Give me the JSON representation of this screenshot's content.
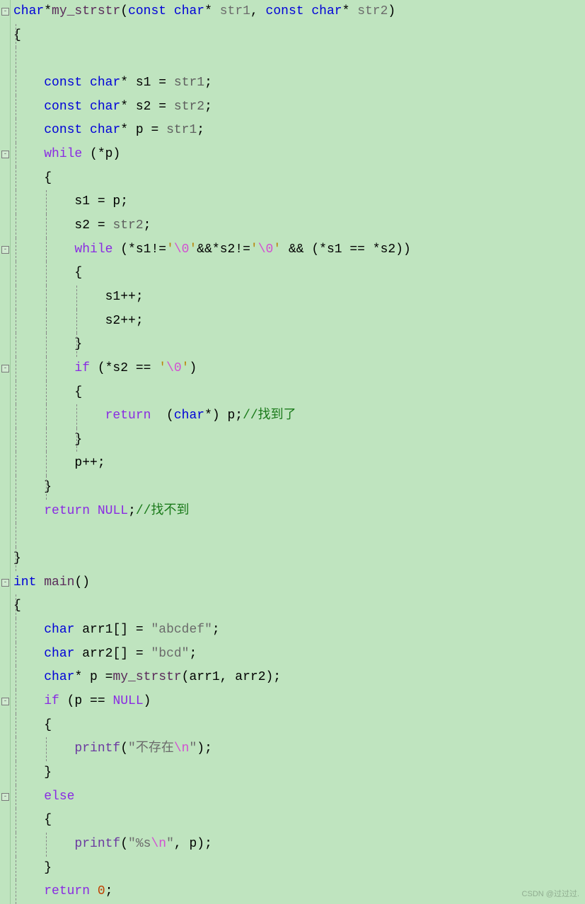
{
  "watermark": "CSDN @过过过.",
  "code": [
    [
      {
        "c": "kw-type",
        "t": "char"
      },
      {
        "t": "*"
      },
      {
        "c": "func",
        "t": "my_strstr"
      },
      {
        "t": "("
      },
      {
        "c": "kw-type",
        "t": "const"
      },
      {
        "t": " "
      },
      {
        "c": "kw-type",
        "t": "char"
      },
      {
        "t": "* "
      },
      {
        "c": "param",
        "t": "str1"
      },
      {
        "t": ", "
      },
      {
        "c": "kw-type",
        "t": "const"
      },
      {
        "t": " "
      },
      {
        "c": "kw-type",
        "t": "char"
      },
      {
        "t": "* "
      },
      {
        "c": "param",
        "t": "str2"
      },
      {
        "t": ")"
      }
    ],
    [
      {
        "t": "{"
      }
    ],
    [
      {
        "t": " "
      }
    ],
    [
      {
        "t": "    "
      },
      {
        "c": "kw-type",
        "t": "const"
      },
      {
        "t": " "
      },
      {
        "c": "kw-type",
        "t": "char"
      },
      {
        "t": "* s1 = "
      },
      {
        "c": "ref",
        "t": "str1"
      },
      {
        "t": ";"
      }
    ],
    [
      {
        "t": "    "
      },
      {
        "c": "kw-type",
        "t": "const"
      },
      {
        "t": " "
      },
      {
        "c": "kw-type",
        "t": "char"
      },
      {
        "t": "* s2 = "
      },
      {
        "c": "ref",
        "t": "str2"
      },
      {
        "t": ";"
      }
    ],
    [
      {
        "t": "    "
      },
      {
        "c": "kw-type",
        "t": "const"
      },
      {
        "t": " "
      },
      {
        "c": "kw-type",
        "t": "char"
      },
      {
        "t": "* p = "
      },
      {
        "c": "ref",
        "t": "str1"
      },
      {
        "t": ";"
      }
    ],
    [
      {
        "t": "    "
      },
      {
        "c": "kw-ctrl",
        "t": "while"
      },
      {
        "t": " (*p)"
      }
    ],
    [
      {
        "t": "    {"
      }
    ],
    [
      {
        "t": "        s1 = p;"
      }
    ],
    [
      {
        "t": "        s2 = "
      },
      {
        "c": "ref",
        "t": "str2"
      },
      {
        "t": ";"
      }
    ],
    [
      {
        "t": "        "
      },
      {
        "c": "kw-ctrl",
        "t": "while"
      },
      {
        "t": " (*s1!="
      },
      {
        "c": "char-lit",
        "t": "'"
      },
      {
        "c": "esc",
        "t": "\\0"
      },
      {
        "c": "char-lit",
        "t": "'"
      },
      {
        "t": "&&*s2!="
      },
      {
        "c": "char-lit",
        "t": "'"
      },
      {
        "c": "esc",
        "t": "\\0"
      },
      {
        "c": "char-lit",
        "t": "'"
      },
      {
        "t": " && (*s1 == *s2))"
      }
    ],
    [
      {
        "t": "        {"
      }
    ],
    [
      {
        "t": "            s1++;"
      }
    ],
    [
      {
        "t": "            s2++;"
      }
    ],
    [
      {
        "t": "        }"
      }
    ],
    [
      {
        "t": "        "
      },
      {
        "c": "kw-ctrl",
        "t": "if"
      },
      {
        "t": " (*s2 == "
      },
      {
        "c": "char-lit",
        "t": "'"
      },
      {
        "c": "esc",
        "t": "\\0"
      },
      {
        "c": "char-lit",
        "t": "'"
      },
      {
        "t": ")"
      }
    ],
    [
      {
        "t": "        {"
      }
    ],
    [
      {
        "t": "            "
      },
      {
        "c": "kw-ctrl",
        "t": "return"
      },
      {
        "t": "  ("
      },
      {
        "c": "kw-type",
        "t": "char"
      },
      {
        "t": "*) p;"
      },
      {
        "c": "comment",
        "t": "//找到了"
      }
    ],
    [
      {
        "t": "        }"
      }
    ],
    [
      {
        "t": "        p++;"
      }
    ],
    [
      {
        "t": "    }"
      }
    ],
    [
      {
        "t": "    "
      },
      {
        "c": "kw-ctrl",
        "t": "return"
      },
      {
        "t": " "
      },
      {
        "c": "const",
        "t": "NULL"
      },
      {
        "t": ";"
      },
      {
        "c": "comment",
        "t": "//找不到"
      }
    ],
    [
      {
        "t": "    "
      }
    ],
    [
      {
        "t": "}"
      }
    ],
    [
      {
        "c": "kw-type",
        "t": "int"
      },
      {
        "t": " "
      },
      {
        "c": "func",
        "t": "main"
      },
      {
        "t": "()"
      }
    ],
    [
      {
        "t": "{"
      }
    ],
    [
      {
        "t": "    "
      },
      {
        "c": "kw-type",
        "t": "char"
      },
      {
        "t": " arr1[] = "
      },
      {
        "c": "str-lit",
        "t": "\"abcdef\""
      },
      {
        "t": ";"
      }
    ],
    [
      {
        "t": "    "
      },
      {
        "c": "kw-type",
        "t": "char"
      },
      {
        "t": " arr2[] = "
      },
      {
        "c": "str-lit",
        "t": "\"bcd\""
      },
      {
        "t": ";"
      }
    ],
    [
      {
        "t": "    "
      },
      {
        "c": "kw-type",
        "t": "char"
      },
      {
        "t": "* p ="
      },
      {
        "c": "func",
        "t": "my_strstr"
      },
      {
        "t": "(arr1, arr2);"
      }
    ],
    [
      {
        "t": "    "
      },
      {
        "c": "kw-ctrl",
        "t": "if"
      },
      {
        "t": " (p == "
      },
      {
        "c": "const",
        "t": "NULL"
      },
      {
        "t": ")"
      }
    ],
    [
      {
        "t": "    {"
      }
    ],
    [
      {
        "t": "        "
      },
      {
        "c": "builtin",
        "t": "printf"
      },
      {
        "t": "("
      },
      {
        "c": "str-lit",
        "t": "\"不存在"
      },
      {
        "c": "esc",
        "t": "\\n"
      },
      {
        "c": "str-lit",
        "t": "\""
      },
      {
        "t": ");"
      }
    ],
    [
      {
        "t": "    }"
      }
    ],
    [
      {
        "t": "    "
      },
      {
        "c": "kw-ctrl",
        "t": "else"
      }
    ],
    [
      {
        "t": "    {"
      }
    ],
    [
      {
        "t": "        "
      },
      {
        "c": "builtin",
        "t": "printf"
      },
      {
        "t": "("
      },
      {
        "c": "str-lit",
        "t": "\"%s"
      },
      {
        "c": "esc",
        "t": "\\n"
      },
      {
        "c": "str-lit",
        "t": "\""
      },
      {
        "t": ", p);"
      }
    ],
    [
      {
        "t": "    }"
      }
    ],
    [
      {
        "t": "    "
      },
      {
        "c": "kw-ctrl",
        "t": "return"
      },
      {
        "t": " "
      },
      {
        "c": "num",
        "t": "0"
      },
      {
        "t": ";"
      }
    ]
  ],
  "foldLines": [
    0,
    6,
    10,
    15,
    24,
    29,
    33
  ],
  "indentGuides": {
    "1": [
      1,
      2,
      3,
      4,
      5,
      6,
      7,
      8,
      9,
      10,
      11,
      12,
      13,
      14,
      15,
      16,
      17,
      18,
      19,
      20,
      21,
      22,
      23,
      25,
      26,
      27,
      28,
      29,
      30,
      31,
      32,
      33,
      34,
      35,
      36,
      37
    ],
    "2": [
      8,
      9,
      10,
      11,
      12,
      13,
      14,
      15,
      16,
      17,
      18,
      19,
      20,
      31,
      35
    ],
    "3": [
      12,
      13,
      14,
      17,
      18
    ]
  }
}
